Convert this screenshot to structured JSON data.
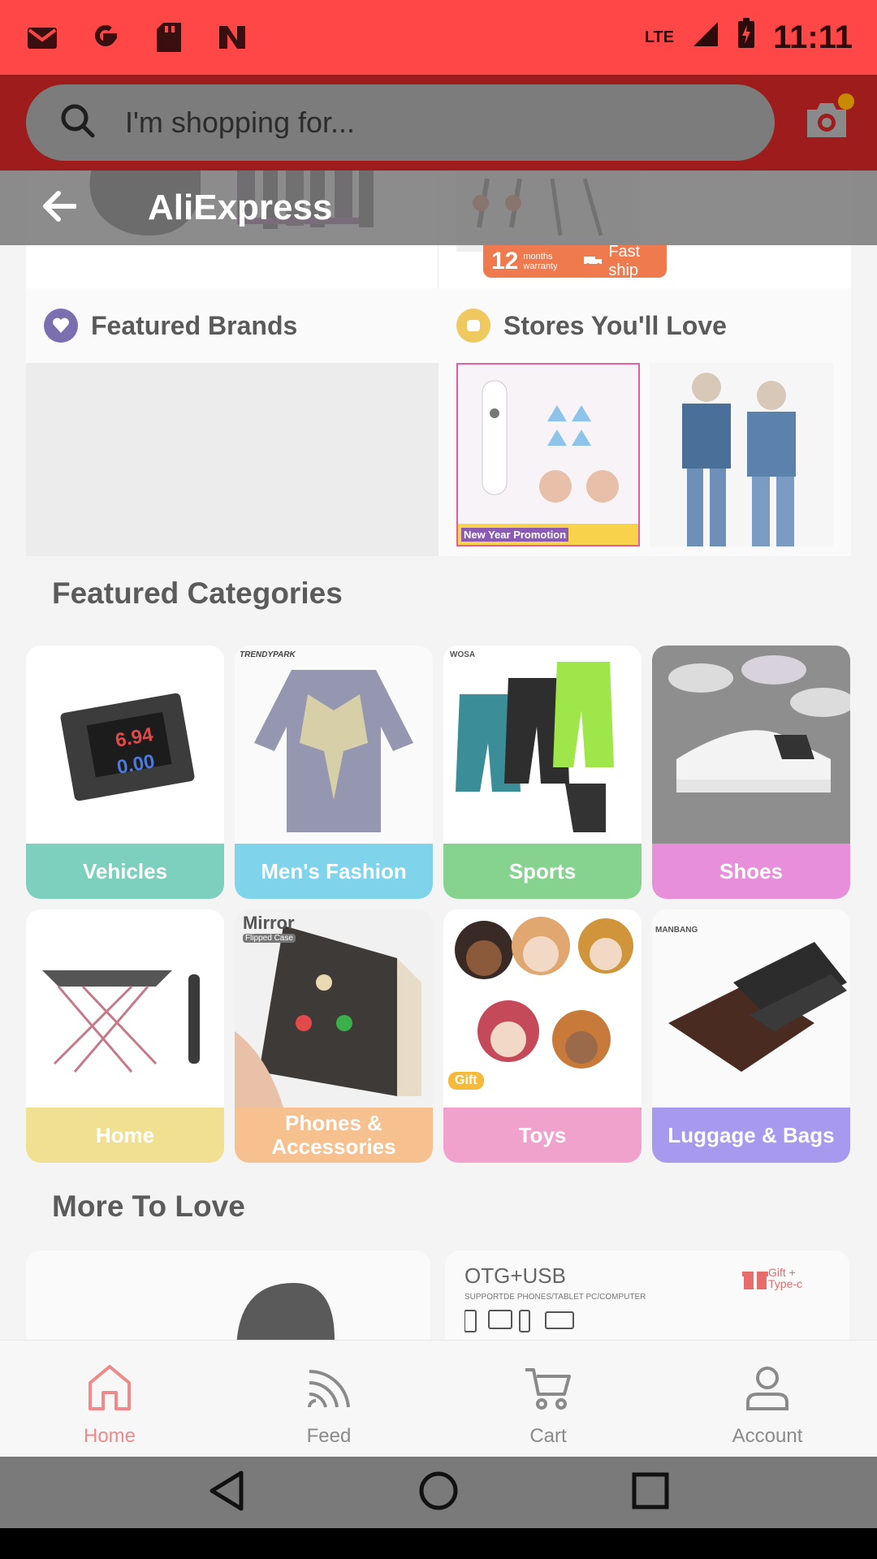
{
  "status_bar": {
    "time": "11:11",
    "network": "LTE",
    "left_icons": [
      "gmail-icon",
      "google-icon",
      "sd-card-icon",
      "notification-app-icon"
    ]
  },
  "search": {
    "placeholder": "I'm shopping for..."
  },
  "header": {
    "title": "AliExpress"
  },
  "promo": {
    "warranty_num": "12",
    "warranty_text": "months warranty",
    "fast_ship": "Fast ship"
  },
  "sections": {
    "featured_brands": "Featured Brands",
    "stores_love": "Stores You'll Love",
    "store_banner_1": "New Year Promotion",
    "featured_categories": "Featured Categories",
    "more_to_love": "More To Love"
  },
  "categories": [
    {
      "label": "Vehicles",
      "color": "#7ed0be"
    },
    {
      "label": "Men's Fashion",
      "color": "#7fd3ea"
    },
    {
      "label": "Sports",
      "color": "#86d38f"
    },
    {
      "label": "Shoes",
      "color": "#e88fda"
    },
    {
      "label": "Home",
      "color": "#f1df92"
    },
    {
      "label": "Phones & Accessories",
      "color": "#f6c08f"
    },
    {
      "label": "Toys",
      "color": "#f0a2cd"
    },
    {
      "label": "Luggage & Bags",
      "color": "#a799ee"
    }
  ],
  "category_art": {
    "vehicles_reading": "6.94",
    "vehicles_reading_2": "0.00",
    "fashion_brand": "TRENDYPARK",
    "sports_brand": "WOSA",
    "phones_brand": "Mirror",
    "phones_sub": "Flipped Case",
    "toys_tag": "Gift",
    "bags_brand": "MANBANG"
  },
  "more_cards": {
    "otg_title": "OTG+USB",
    "otg_sub": "SUPPORTDE PHONES/TABLET PC/COMPUTER",
    "gift_tag": "Gift + Type-c"
  },
  "bottom_nav": [
    {
      "label": "Home",
      "active": true
    },
    {
      "label": "Feed",
      "active": false
    },
    {
      "label": "Cart",
      "active": false
    },
    {
      "label": "Account",
      "active": false
    }
  ],
  "colors": {
    "status_bar": "#ff4747",
    "search_header": "#9e1c1c",
    "active_nav": "#f08a8a"
  }
}
